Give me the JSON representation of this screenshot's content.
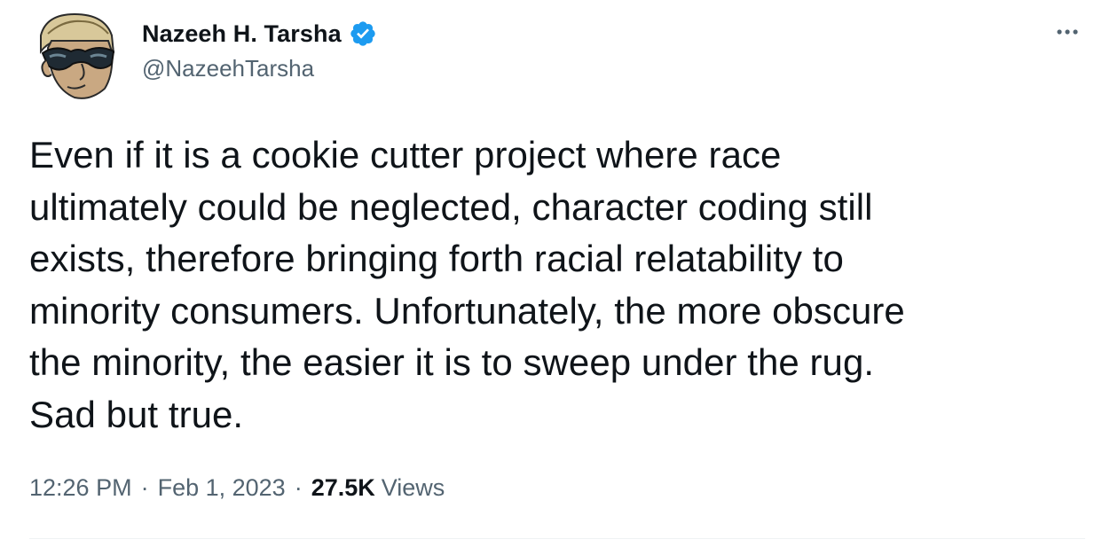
{
  "author": {
    "name": "Nazeeh H. Tarsha",
    "handle": "@NazeehTarsha",
    "verified": true,
    "verified_color": "#1d9bf0"
  },
  "tweet": {
    "text": "Even if it is a cookie cutter project where race\nultimately could be neglected, character coding still\nexists, therefore bringing forth racial relatability to\nminority consumers. Unfortunately, the more obscure\nthe minority, the easier it is to sweep under the rug.\nSad but true."
  },
  "meta": {
    "time": "12:26 PM",
    "separator": "·",
    "date": "Feb 1, 2023",
    "views_count": "27.5K",
    "views_label": "Views"
  },
  "icons": {
    "more": "more-horizontal-icon",
    "verified": "verified-badge-icon"
  },
  "colors": {
    "text_primary": "#0f1419",
    "text_secondary": "#536471",
    "divider": "#eff3f4"
  }
}
